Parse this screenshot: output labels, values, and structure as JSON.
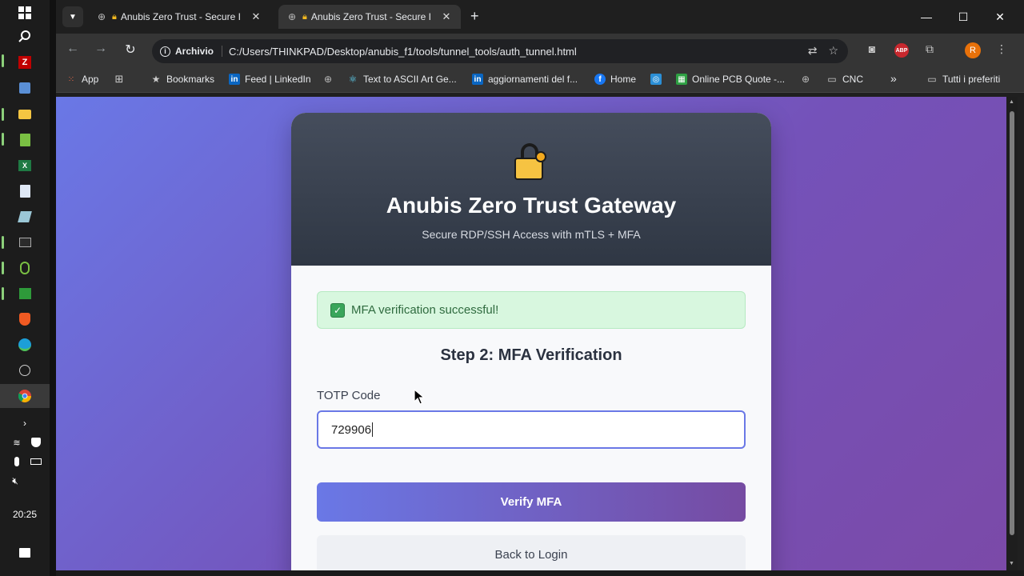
{
  "taskbar": {
    "time": "20:25",
    "icons": [
      "windows-start-icon",
      "search-icon",
      "filezilla-icon",
      "network-icon",
      "file-explorer-icon",
      "notepad-icon",
      "excel-icon",
      "calculator-icon",
      "sketch-icon",
      "terminal-icon",
      "paperclip-icon",
      "bar-chart-icon",
      "brave-icon",
      "edge-icon",
      "clock-app-icon",
      "chrome-icon"
    ]
  },
  "browser": {
    "tabs": [
      {
        "title": "Anubis Zero Trust - Secure I",
        "active": false
      },
      {
        "title": "Anubis Zero Trust - Secure I",
        "active": true
      }
    ],
    "address_chip": "Archivio",
    "url": "C:/Users/THINKPAD/Desktop/anubis_f1/tools/tunnel_tools/auth_tunnel.html",
    "avatar_initial": "R",
    "adblock_label": "ABP",
    "bookmarks": [
      {
        "label": "App"
      },
      {
        "label": ""
      },
      {
        "label": "Bookmarks"
      },
      {
        "label": "Feed | LinkedIn"
      },
      {
        "label": ""
      },
      {
        "label": "Text to ASCII Art Ge..."
      },
      {
        "label": "aggiornamenti del f..."
      },
      {
        "label": "Home"
      },
      {
        "label": ""
      },
      {
        "label": "Online PCB Quote -..."
      },
      {
        "label": ""
      },
      {
        "label": "CNC"
      },
      {
        "label": "»"
      },
      {
        "label": "Tutti i preferiti"
      }
    ]
  },
  "page": {
    "title": "Anubis Zero Trust Gateway",
    "subtitle": "Secure RDP/SSH Access with mTLS + MFA",
    "alert": "MFA verification successful!",
    "step_title": "Step 2: MFA Verification",
    "field_label": "TOTP Code",
    "field_value": "729906",
    "verify_button": "Verify MFA",
    "back_button": "Back to Login"
  },
  "colors": {
    "gradient_start": "#6a78e6",
    "gradient_end": "#764ba2",
    "header_dark": "#2f3744",
    "success_bg": "#d8f7df",
    "success_text": "#2f6b3f"
  }
}
